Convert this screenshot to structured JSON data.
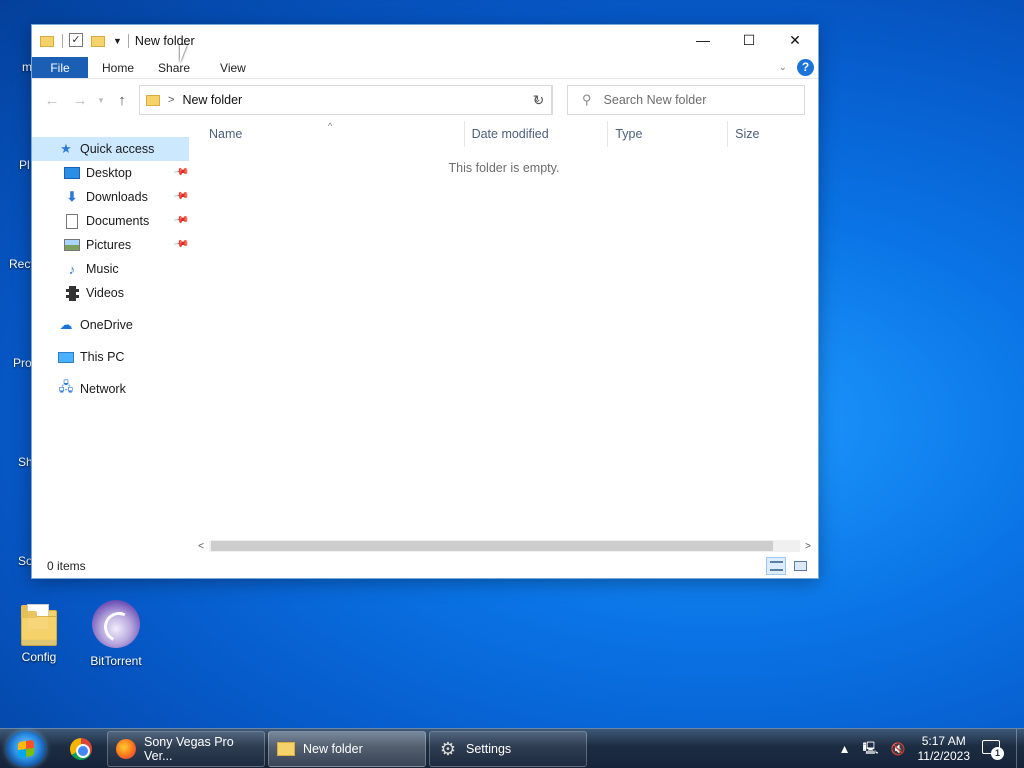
{
  "window": {
    "title": "New folder",
    "controls": {
      "minimize": "—",
      "maximize": "☐",
      "close": "✕"
    }
  },
  "ribbon": {
    "tabs": [
      "File",
      "Home",
      "Share",
      "View"
    ],
    "help": "?"
  },
  "navbar": {
    "path": "New folder",
    "search_placeholder": "Search New folder"
  },
  "sidebar": {
    "quick_access": "Quick access",
    "items": [
      {
        "label": "Desktop",
        "icon": "desktop-icon",
        "pinned": true
      },
      {
        "label": "Downloads",
        "icon": "download-icon",
        "pinned": true
      },
      {
        "label": "Documents",
        "icon": "documents-icon",
        "pinned": true
      },
      {
        "label": "Pictures",
        "icon": "pictures-icon",
        "pinned": true
      },
      {
        "label": "Music",
        "icon": "music-icon",
        "pinned": false
      },
      {
        "label": "Videos",
        "icon": "videos-icon",
        "pinned": false
      }
    ],
    "onedrive": "OneDrive",
    "this_pc": "This PC",
    "network": "Network"
  },
  "columns": [
    "Name",
    "Date modified",
    "Type",
    "Size"
  ],
  "empty_message": "This folder is empty.",
  "status": {
    "count": "0 items"
  },
  "desktop": {
    "icons": [
      {
        "label": "Config",
        "icon": "folder-icon"
      },
      {
        "label": "BitTorrent",
        "icon": "bittorrent-icon"
      }
    ],
    "partial_labels": [
      "m",
      "Pl",
      "Recy",
      "Pro",
      "Sh",
      "So"
    ]
  },
  "taskbar": {
    "tasks": [
      {
        "label": "Sony Vegas Pro Ver...",
        "icon": "firefox-icon"
      },
      {
        "label": "New folder",
        "icon": "folder-icon"
      },
      {
        "label": "Settings",
        "icon": "gear-icon"
      }
    ],
    "time": "5:17 AM",
    "date": "11/2/2023",
    "notification_count": "1"
  },
  "colors": {
    "accent": "#1a5fb4",
    "selection": "#cce8ff",
    "folder": "#f6d26b"
  }
}
